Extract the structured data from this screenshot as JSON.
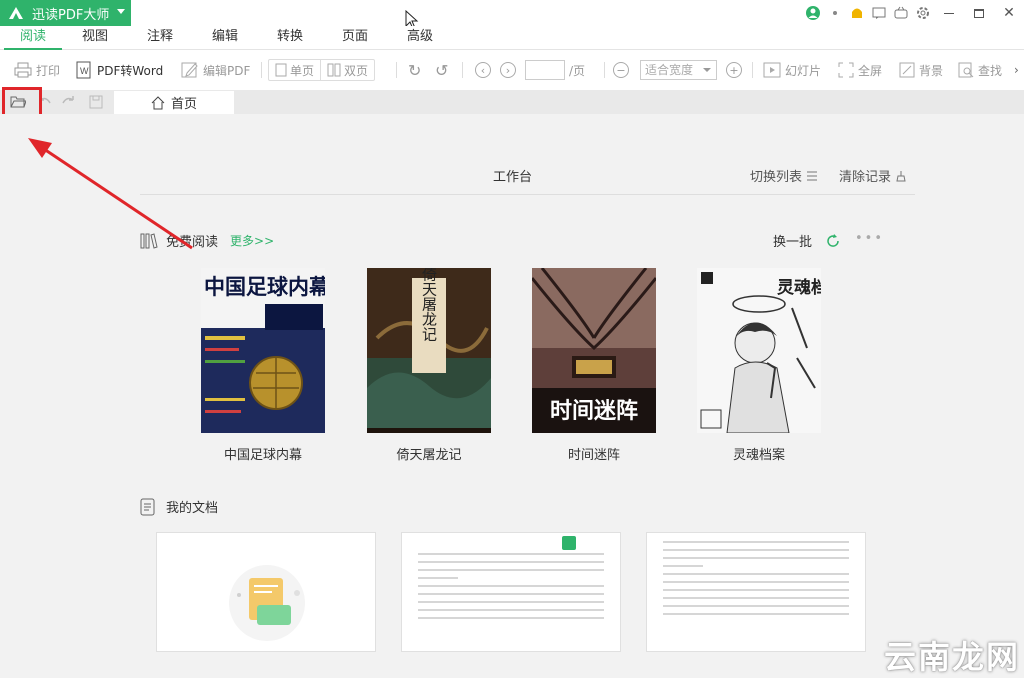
{
  "app": {
    "title": "迅读PDF大师"
  },
  "menu": {
    "tabs": [
      "阅读",
      "视图",
      "注释",
      "编辑",
      "转换",
      "页面",
      "高级"
    ],
    "active": "阅读"
  },
  "toolbar": {
    "print": "打印",
    "pdf_to_word": "PDF转Word",
    "edit_pdf": "编辑PDF",
    "single_page": "单页",
    "double_page": "双页",
    "page_suffix": "/页",
    "zoom": "适合宽度",
    "slideshow": "幻灯片",
    "fullscreen": "全屏",
    "background": "背景",
    "find": "查找"
  },
  "tabs": {
    "home": "首页"
  },
  "workbench": {
    "title": "工作台",
    "switch_list": "切换列表",
    "clear_records": "清除记录"
  },
  "free_reading": {
    "title": "免费阅读",
    "more": "更多>>",
    "refresh": "换一批",
    "books": [
      {
        "title": "中国足球内幕",
        "cover_text": "中国足球内幕"
      },
      {
        "title": "倚天屠龙记",
        "cover_text": "倚天屠龙记"
      },
      {
        "title": "时间迷阵",
        "cover_text": "时间迷阵"
      },
      {
        "title": "灵魂档案",
        "cover_text": "灵魂档案"
      }
    ]
  },
  "my_docs": {
    "title": "我的文档"
  },
  "watermark": "云南龙网",
  "colors": {
    "brand": "#2fb36b",
    "highlight": "#e0262a"
  }
}
